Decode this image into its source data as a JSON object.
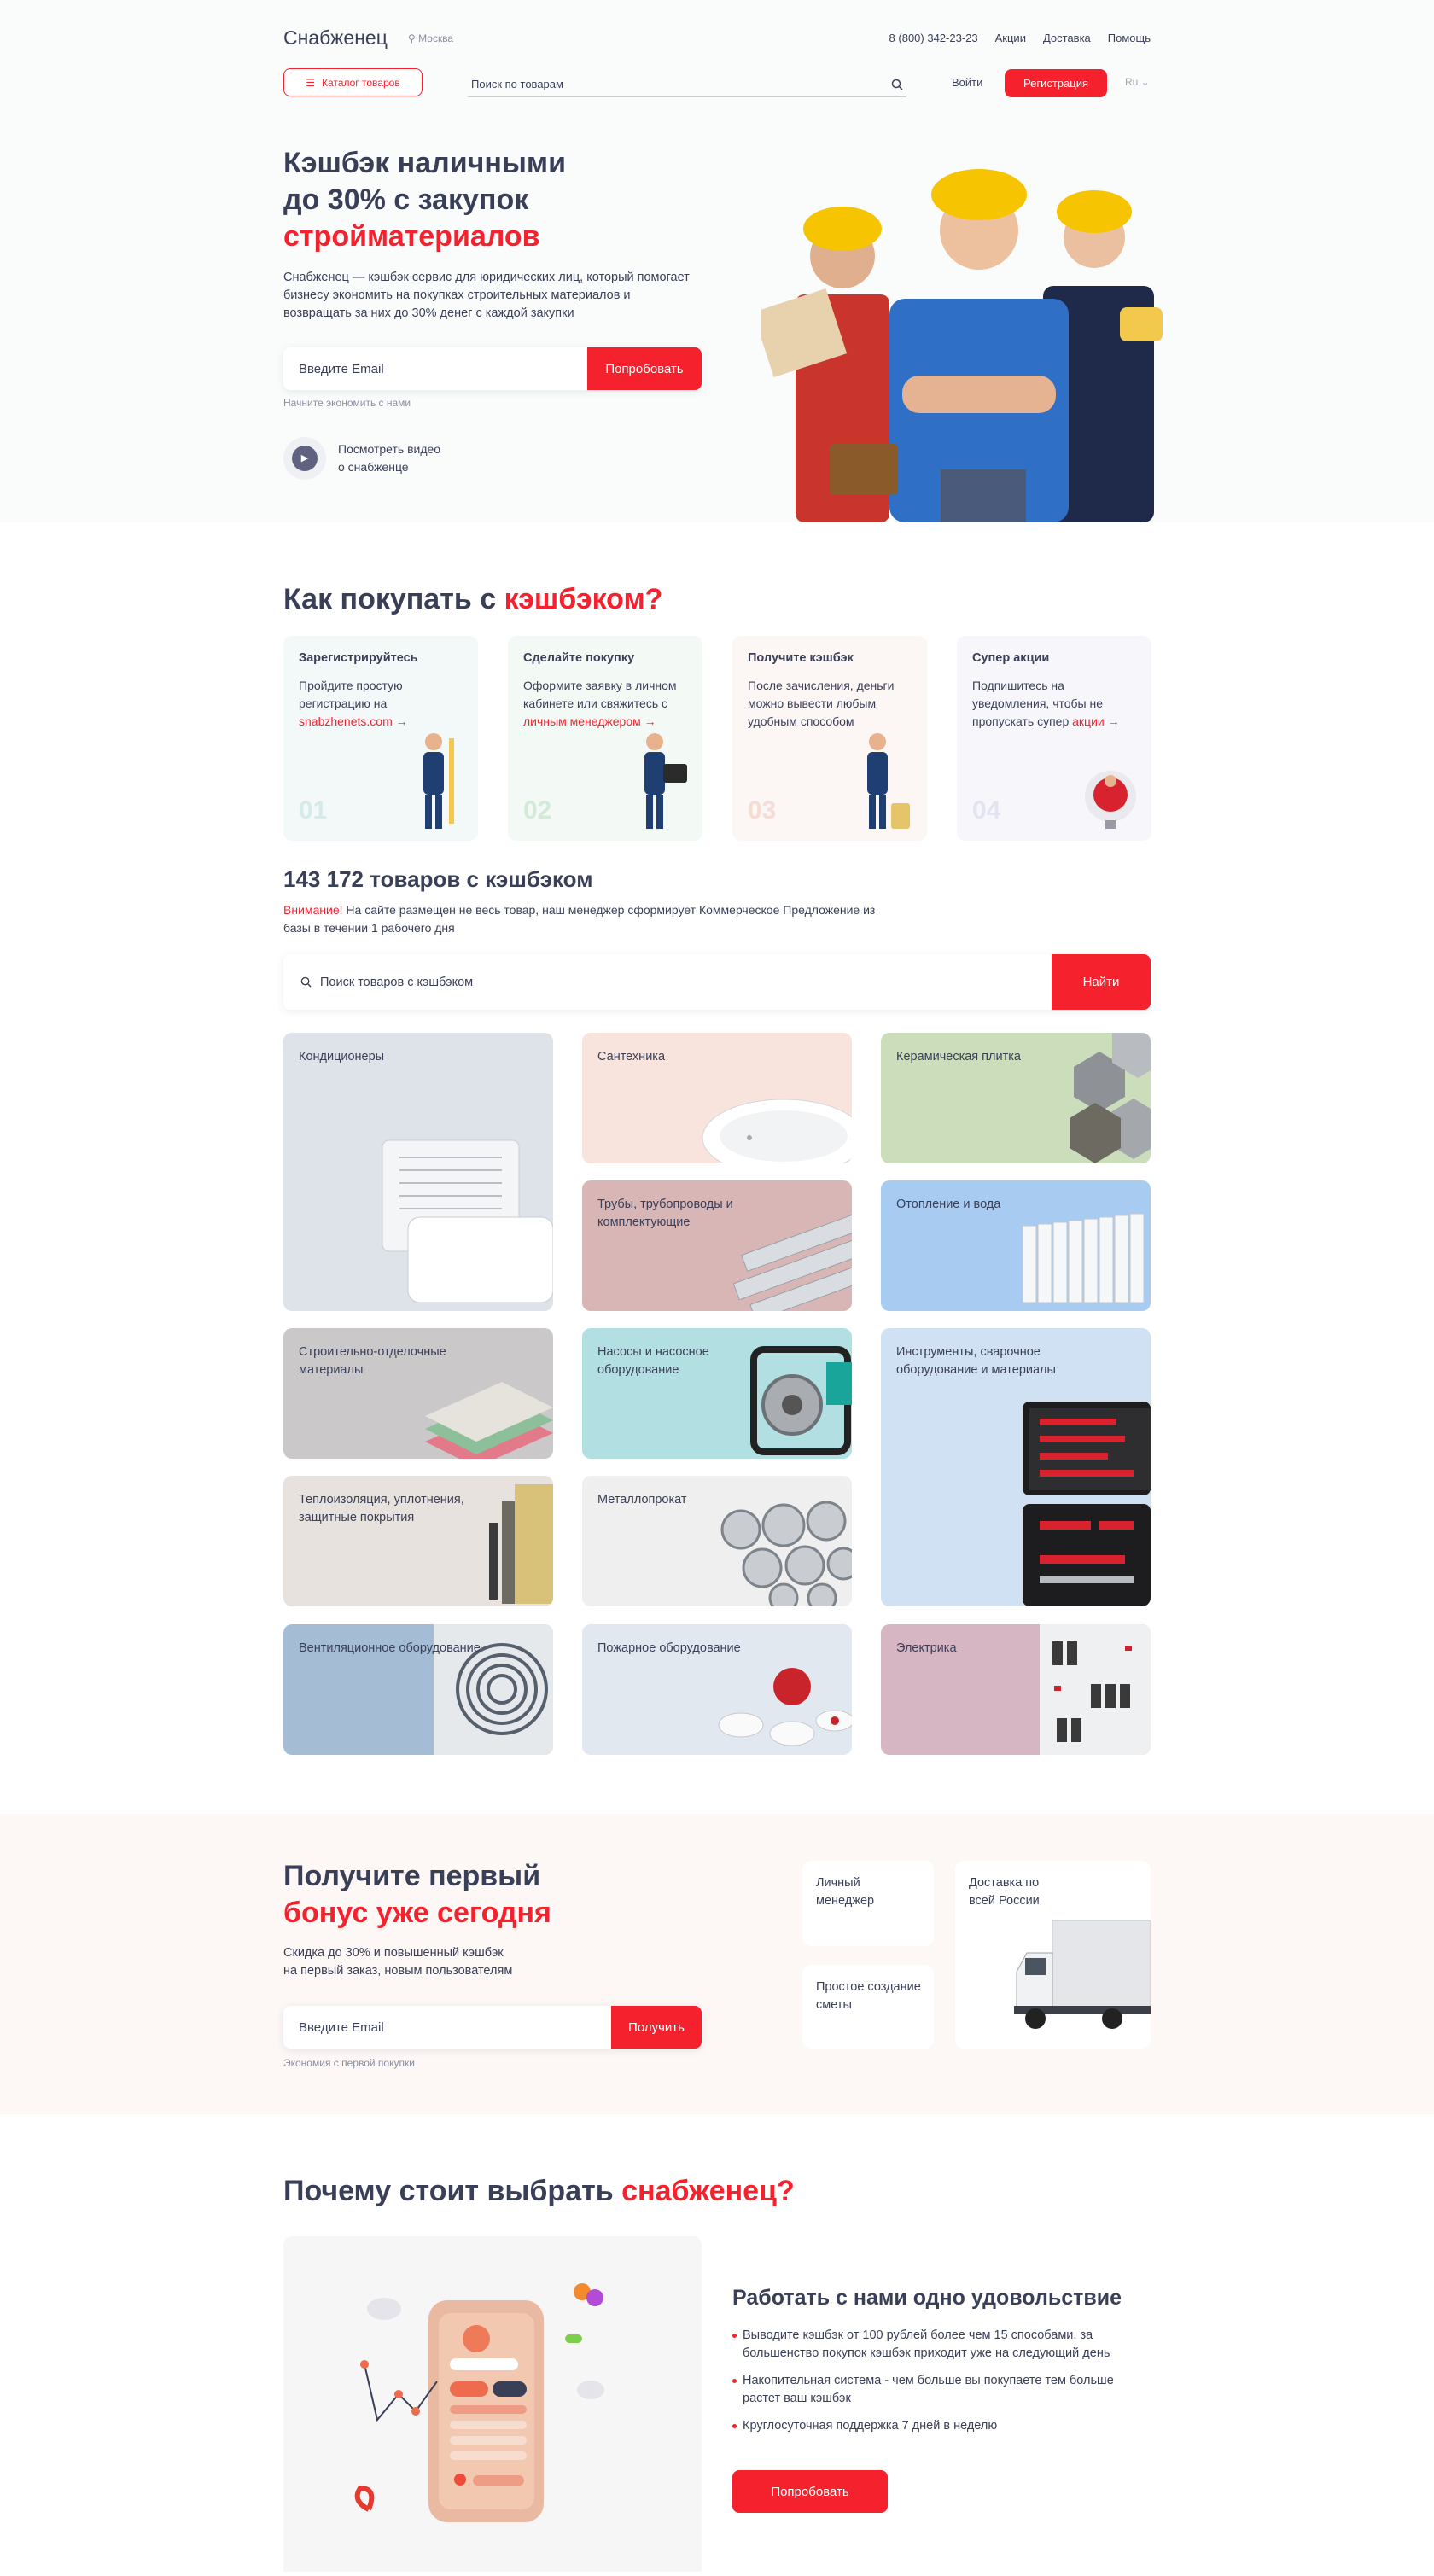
{
  "header": {
    "logo": "Снабженец",
    "city": "Москва",
    "phone": "8 (800) 342-23-23",
    "nav": [
      "Акции",
      "Доставка",
      "Помощь"
    ],
    "catalog_label": "Каталог товаров",
    "search_placeholder": "Поиск по товарам",
    "login_label": "Войти",
    "register_label": "Регистрация",
    "lang": "Ru"
  },
  "hero": {
    "title_line1": "Кэшбэк наличными",
    "title_line2": "до 30% с закупок",
    "title_accent": "стройматериалов",
    "description": "Снабженец — кэшбэк сервис для юридических лиц, который помогает бизнесу экономить на покупках строительных материалов и возвращать за них до 30% денег с каждой закупки",
    "email_placeholder": "Введите Email",
    "cta_label": "Попробовать",
    "hint": "Начните экономить с нами",
    "video_line1": "Посмотреть видео",
    "video_line2": "о снабженце"
  },
  "how": {
    "title": "Как покупать с ",
    "title_accent": "кэшбэком?",
    "steps": [
      {
        "title": "Зарегистрируйтесь",
        "text": "Пройдите простую регистрацию на ",
        "link": "snabzhenets.com",
        "tail": "",
        "num": "01",
        "bg": "#f3f8f9"
      },
      {
        "title": "Сделайте покупку",
        "text": "Оформите заявку в личном кабинете или свяжитесь с ",
        "link": "личным менеджером",
        "tail": "",
        "num": "02",
        "bg": "#f3f9f4"
      },
      {
        "title": "Получите кэшбэк",
        "text": "После зачисления, деньги можно вывести любым удобным способом",
        "link": "",
        "tail": "",
        "num": "03",
        "bg": "#fcf6f4"
      },
      {
        "title": "Супер акции",
        "text": "Подпишитесь на уведомления, чтобы не пропускать супер ",
        "link": "акции",
        "tail": "",
        "num": "04",
        "bg": "#f7f7fb"
      }
    ]
  },
  "catalog": {
    "count_title": "143 172 товаров с кэшбэком",
    "notice_accent": "Внимание!",
    "notice": " На сайте размещен не весь товар, наш менеджер сформирует Коммерческое Предложение из базы в течении 1 рабочего дня",
    "search_placeholder": "Поиск товаров с кэшбэком",
    "search_button": "Найти",
    "categories": [
      {
        "label": "Кондиционеры",
        "bg": "#dde3e8"
      },
      {
        "label": "Сантехника",
        "bg": "#f8e4dc"
      },
      {
        "label": "Керамическая плитка",
        "bg": "#ccddbc"
      },
      {
        "label": "Трубы, трубопроводы и комплектующие",
        "bg": "#d8b6b6"
      },
      {
        "label": "Отопление и вода",
        "bg": "#a8cbf2"
      },
      {
        "label": "Строительно-отделочные материалы",
        "bg": "#cbc8c9"
      },
      {
        "label": "Насосы и насосное оборудование",
        "bg": "#b2e0e2"
      },
      {
        "label": "Инструменты, сварочное оборудование и материалы",
        "bg": "#d0e1f3"
      },
      {
        "label": "Теплоизоляция, уплотнения, защитные покрытия",
        "bg": "#e8e2de"
      },
      {
        "label": "Металлопрокат",
        "bg": "#f0efef"
      },
      {
        "label": "Вентиляционное оборудование",
        "bg": "#a4bdd5"
      },
      {
        "label": "Пожарное оборудование",
        "bg": "#e2e8f0"
      },
      {
        "label": "Электрика",
        "bg": "#d7b6c3"
      }
    ]
  },
  "bonus": {
    "title": "Получите первый",
    "title_accent": "бонус уже сегодня",
    "description_line1": "Скидка до 30% и повышенный кэшбэк",
    "description_line2": "на первый заказ, новым пользователям",
    "email_placeholder": "Введите Email",
    "cta_label": "Получить",
    "hint": "Экономия с первой покупки",
    "features": [
      "Личный менеджер",
      "Простое создание сметы",
      "Доставка по всей России"
    ]
  },
  "why": {
    "title": "Почему стоит выбрать ",
    "title_accent": "снабженец?",
    "subtitle": "Работать с нами одно удовольствие",
    "points": [
      "Выводите кэшбэк от 100 рублей более чем 15 способами, за большенство покупок кэшбэк приходит уже на следующий день",
      "Накопительная система - чем больше вы покупаете тем больше растет ваш кэшбэк",
      "Круглосуточная поддержка 7 дней в неделю"
    ],
    "cta_label": "Попробовать"
  },
  "colors": {
    "accent": "#f5222d",
    "text": "#3a3f58"
  }
}
